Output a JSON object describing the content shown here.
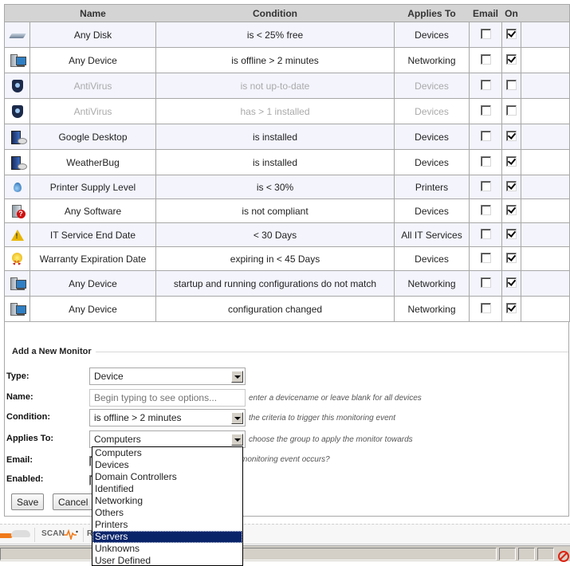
{
  "table": {
    "headers": [
      "",
      "Name",
      "Condition",
      "Applies To",
      "Email",
      "On",
      ""
    ],
    "rows": [
      {
        "icon": "disk-icon",
        "name": "Any Disk",
        "condition": "is < 25% free",
        "applies_to": "Devices",
        "email": false,
        "on": true,
        "disabled": false
      },
      {
        "icon": "computer-icon",
        "name": "Any Device",
        "condition": "is offline > 2 minutes",
        "applies_to": "Networking",
        "email": false,
        "on": true,
        "disabled": false
      },
      {
        "icon": "shield-icon",
        "name": "AntiVirus",
        "condition": "is not up-to-date",
        "applies_to": "Devices",
        "email": false,
        "on": false,
        "disabled": true
      },
      {
        "icon": "shield-icon",
        "name": "AntiVirus",
        "condition": "has > 1 installed",
        "applies_to": "Devices",
        "email": false,
        "on": false,
        "disabled": true
      },
      {
        "icon": "software-box-icon",
        "name": "Google Desktop",
        "condition": "is installed",
        "applies_to": "Devices",
        "email": false,
        "on": true,
        "disabled": false
      },
      {
        "icon": "software-box-icon",
        "name": "WeatherBug",
        "condition": "is installed",
        "applies_to": "Devices",
        "email": false,
        "on": true,
        "disabled": false
      },
      {
        "icon": "ink-drop-icon",
        "name": "Printer Supply Level",
        "condition": "is < 30%",
        "applies_to": "Printers",
        "email": false,
        "on": true,
        "disabled": false
      },
      {
        "icon": "unknown-software-icon",
        "name": "Any Software",
        "condition": "is not compliant",
        "applies_to": "Devices",
        "email": false,
        "on": true,
        "disabled": false
      },
      {
        "icon": "warning-icon",
        "name": "IT Service End Date",
        "condition": "< 30 Days",
        "applies_to": "All IT Services",
        "email": false,
        "on": true,
        "disabled": false
      },
      {
        "icon": "award-ribbon-icon",
        "name": "Warranty Expiration Date",
        "condition": "expiring in < 45 Days",
        "applies_to": "Devices",
        "email": false,
        "on": true,
        "disabled": false
      },
      {
        "icon": "computer-icon",
        "name": "Any Device",
        "condition": "startup and running configurations do not match",
        "applies_to": "Networking",
        "email": false,
        "on": true,
        "disabled": false
      },
      {
        "icon": "computer-icon",
        "name": "Any Device",
        "condition": "configuration changed",
        "applies_to": "Networking",
        "email": false,
        "on": true,
        "disabled": false
      }
    ]
  },
  "form": {
    "legend": "Add a New Monitor",
    "type_label": "Type:",
    "type_value": "Device",
    "name_label": "Name:",
    "name_placeholder": "Begin typing to see options...",
    "name_hint": "enter a devicename or leave blank for all devices",
    "condition_label": "Condition:",
    "condition_value": "is offline > 2 minutes",
    "condition_hint": "the criteria to trigger this monitoring event",
    "applies_label": "Applies To:",
    "applies_value": "Computers",
    "applies_hint": "choose the group to apply the monitor towards",
    "email_label": "Email:",
    "email_hint": "monitoring event occurs?",
    "enabled_label": "Enabled:",
    "save_label": "Save",
    "cancel_label": "Cancel"
  },
  "dropdown": {
    "options": [
      "Computers",
      "Devices",
      "Domain Controllers",
      "Identified",
      "Networking",
      "Others",
      "Printers",
      "Servers",
      "Unknowns",
      "User Defined"
    ],
    "highlighted": "Servers"
  },
  "toolbar": {
    "scan_label": "SCAN",
    "next_label": "R"
  }
}
